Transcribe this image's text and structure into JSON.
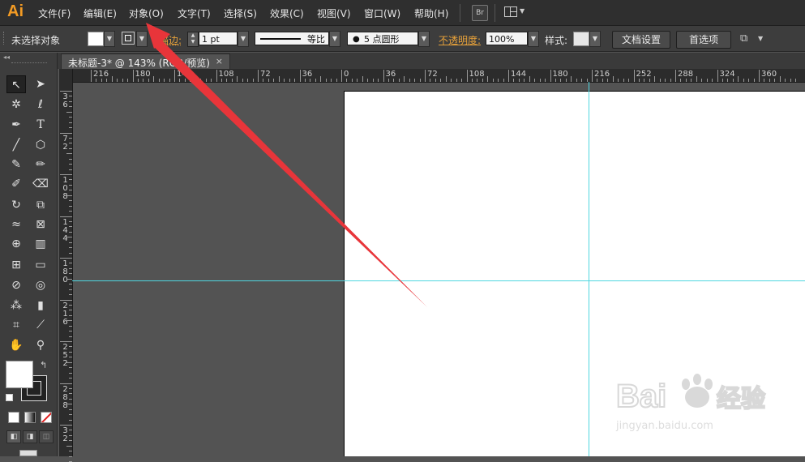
{
  "app": {
    "logo": "Ai"
  },
  "menu": [
    "文件(F)",
    "编辑(E)",
    "对象(O)",
    "文字(T)",
    "选择(S)",
    "效果(C)",
    "视图(V)",
    "窗口(W)",
    "帮助(H)"
  ],
  "menubar_buttons": {
    "bridge": "Br"
  },
  "control": {
    "selection_status": "未选择对象",
    "stroke_label": "描边:",
    "stroke_weight": "1 pt",
    "stroke_profile": "等比",
    "brush": "5 点圆形",
    "opacity_label": "不透明度:",
    "opacity_value": "100%",
    "style_label": "样式:",
    "doc_setup": "文档设置",
    "preferences": "首选项"
  },
  "document": {
    "tab_title": "未标题-3* @ 143% (RGB/预览)",
    "close": "×"
  },
  "ruler": {
    "h_labels": [
      "216",
      "180",
      "144",
      "108",
      "72",
      "36",
      "0",
      "36",
      "72",
      "108",
      "144",
      "180",
      "216",
      "252",
      "288",
      "324",
      "360"
    ],
    "v_labels": [
      [
        "3",
        "6"
      ],
      [
        "7",
        "2"
      ],
      [
        "1",
        "0",
        "8"
      ],
      [
        "1",
        "4",
        "4"
      ],
      [
        "1",
        "8",
        "0"
      ],
      [
        "2",
        "1",
        "6"
      ],
      [
        "2",
        "5",
        "2"
      ],
      [
        "2",
        "8",
        "8"
      ],
      [
        "3",
        "2"
      ]
    ]
  },
  "watermark": {
    "url": "jingyan.baidu.com"
  },
  "colors": {
    "accent": "#f39b24",
    "guide": "#4fd6e0",
    "arrow": "#e8353a",
    "opacity_label": "#e8a23a"
  }
}
